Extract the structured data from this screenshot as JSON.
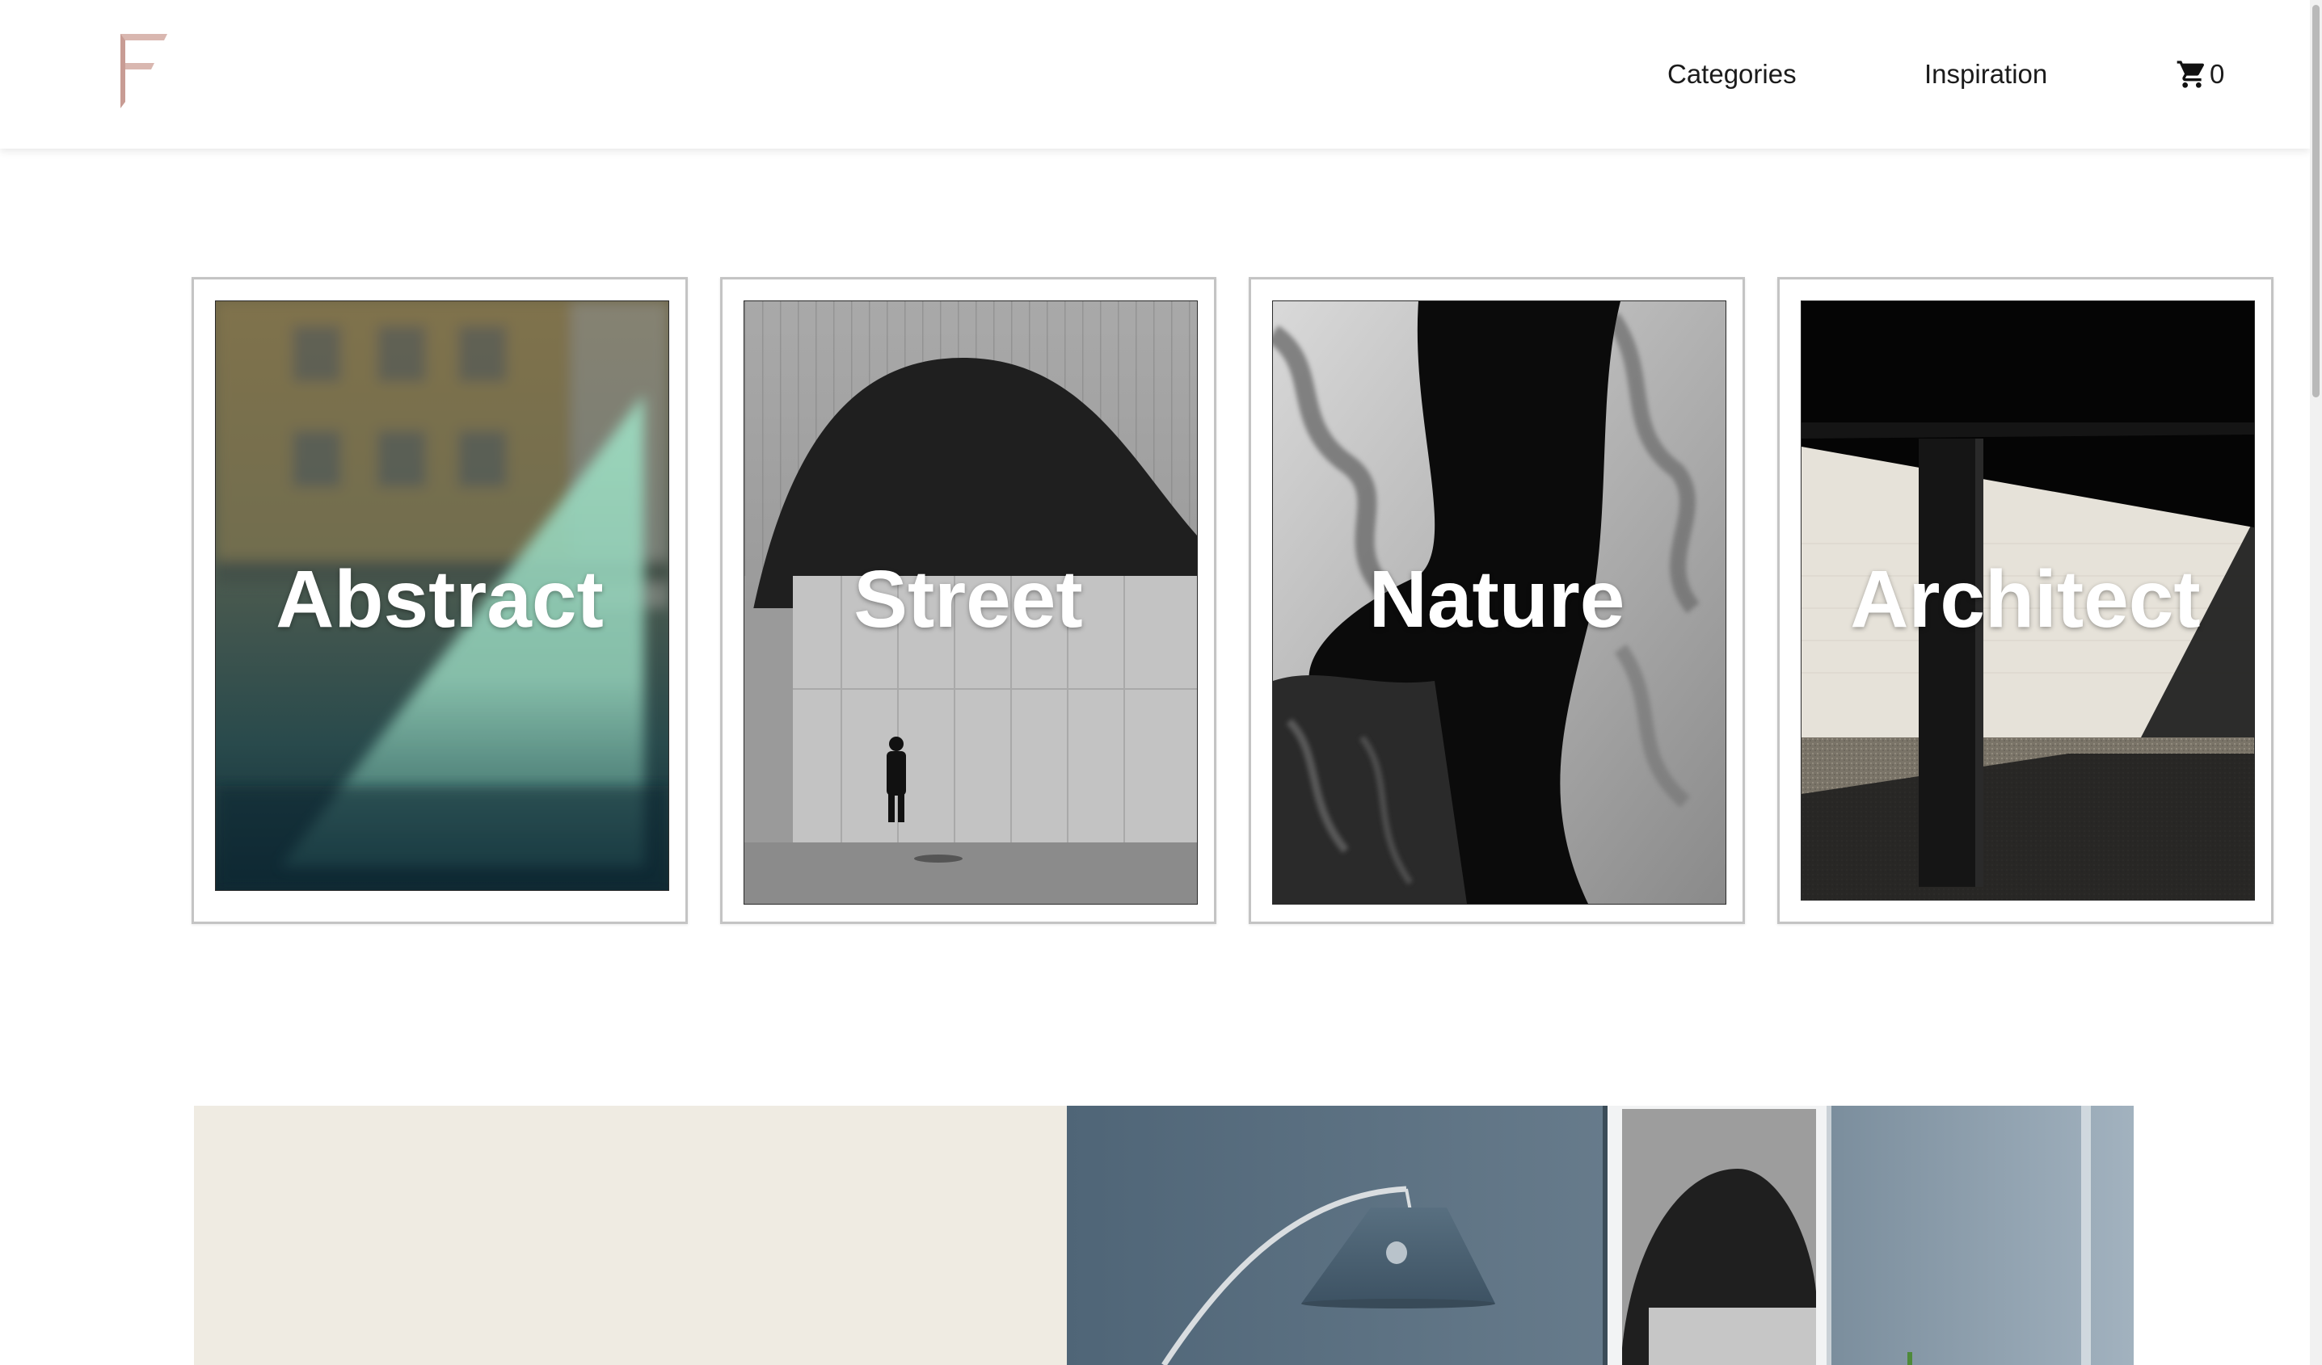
{
  "header": {
    "logo_icon": "brand-logo-f",
    "logo_color": "#d9b7b0",
    "nav": {
      "categories": "Categories",
      "inspiration": "Inspiration"
    },
    "cart": {
      "icon": "cart-icon",
      "count": "0"
    }
  },
  "categories": [
    {
      "label": "Abstract"
    },
    {
      "label": "Street"
    },
    {
      "label": "Nature"
    },
    {
      "label": "Architect"
    }
  ],
  "banner": {
    "left_color": "#efebe2",
    "right_color": "#4f6577"
  }
}
